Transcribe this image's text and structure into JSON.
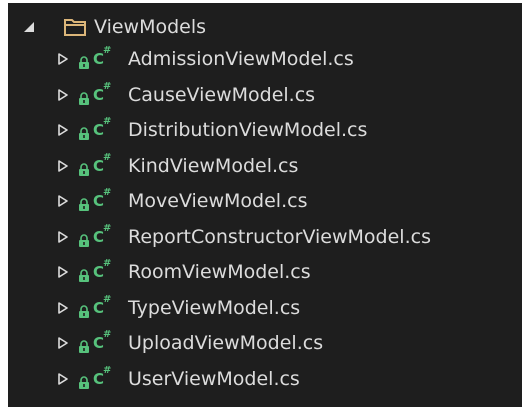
{
  "folder": {
    "label": "ViewModels",
    "expanded": true
  },
  "files": [
    {
      "label": "AdmissionViewModel.cs"
    },
    {
      "label": "CauseViewModel.cs"
    },
    {
      "label": "DistributionViewModel.cs"
    },
    {
      "label": "KindViewModel.cs"
    },
    {
      "label": "MoveViewModel.cs"
    },
    {
      "label": "ReportConstructorViewModel.cs"
    },
    {
      "label": "RoomViewModel.cs"
    },
    {
      "label": "TypeViewModel.cs"
    },
    {
      "label": "UploadViewModel.cs"
    },
    {
      "label": "UserViewModel.cs"
    }
  ],
  "icons": {
    "expander_expanded": "triangle-down-right-icon",
    "expander_collapsed": "triangle-right-icon",
    "folder": "folder-icon",
    "lock": "lock-icon",
    "csharp_file": "csharp-file-icon"
  },
  "colors": {
    "background": "#1e1e1e",
    "text": "#dcdcdc",
    "csharp_icon": "#57c27c",
    "lock_icon": "#57c27c",
    "folder_icon": "#dcb67a"
  },
  "csharp_glyph": {
    "letter": "C",
    "mark": "#"
  }
}
